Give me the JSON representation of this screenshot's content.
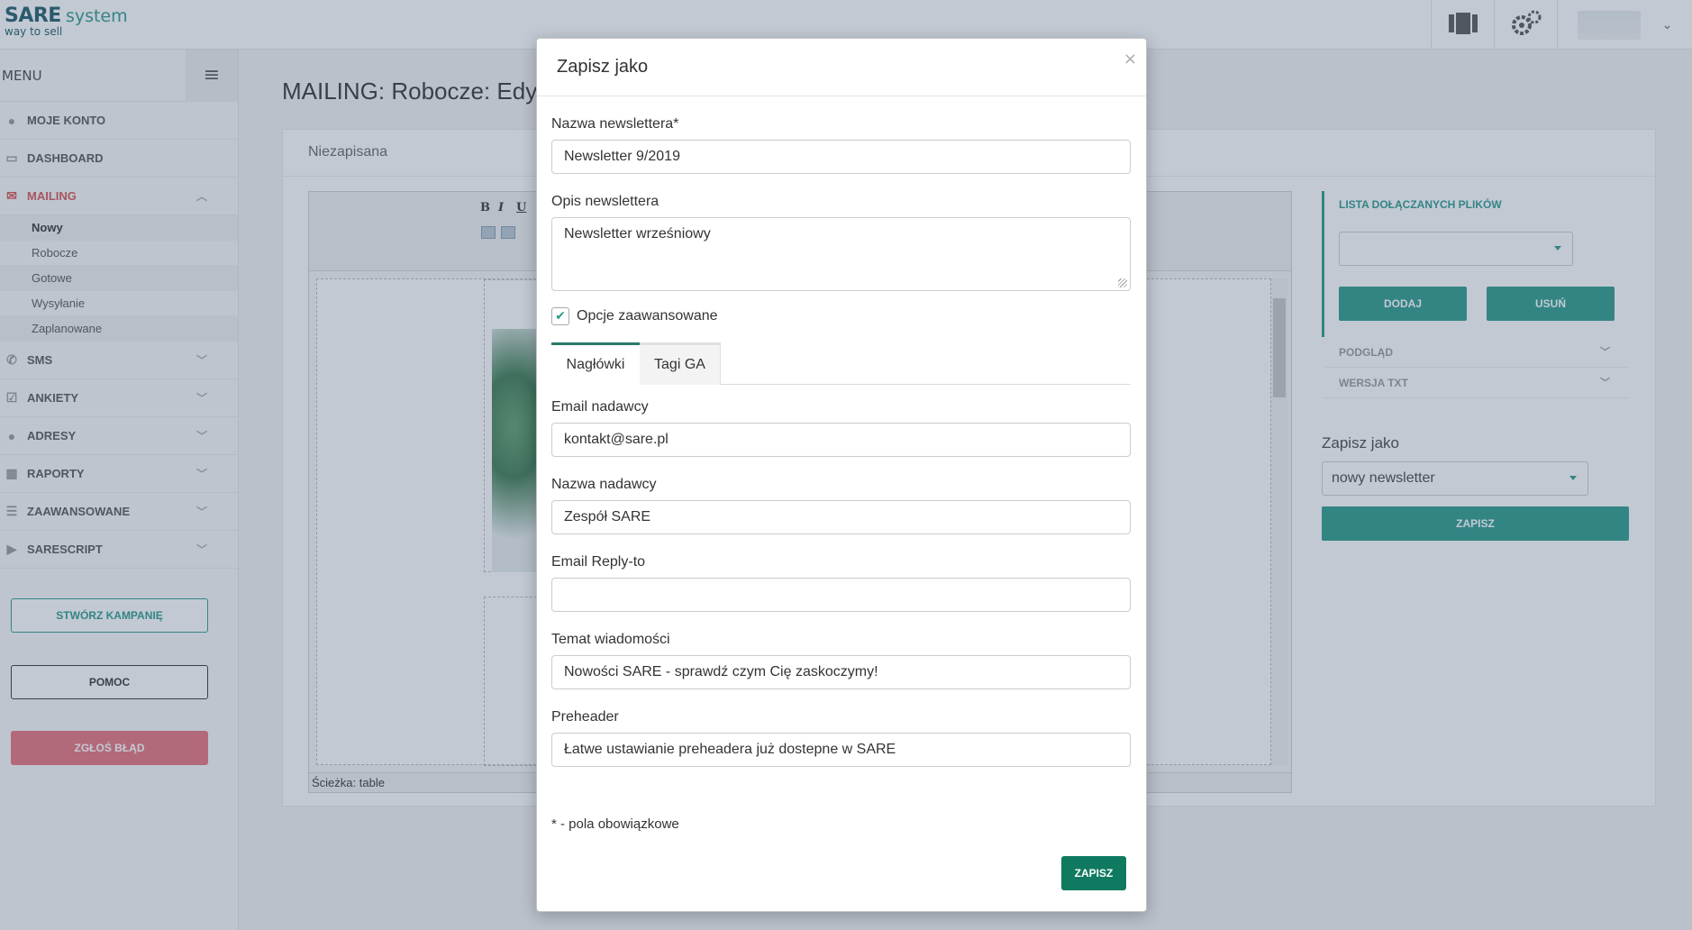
{
  "app": {
    "logo_brand": "SARE",
    "logo_product": "system",
    "logo_tagline": "way to sell",
    "icons": {
      "top_library": "library-icon",
      "top_settings": "gears-icon",
      "user_dropdown": "chevron-down-icon"
    }
  },
  "sidebar": {
    "menu_label": "MENU",
    "items": [
      {
        "label": "MOJE KONTO",
        "icon": "user-icon"
      },
      {
        "label": "DASHBOARD",
        "icon": "monitor-icon"
      },
      {
        "label": "MAILING",
        "icon": "envelope-icon"
      },
      {
        "label": "SMS",
        "icon": "phone-icon"
      },
      {
        "label": "ANKIETY",
        "icon": "checkbox-icon"
      },
      {
        "label": "ADRESY",
        "icon": "user-icon"
      },
      {
        "label": "RAPORTY",
        "icon": "table-icon"
      },
      {
        "label": "ZAAWANSOWANE",
        "icon": "list-icon"
      },
      {
        "label": "SARESCRIPT",
        "icon": "play-icon"
      }
    ],
    "mailing_sub": [
      "Nowy",
      "Robocze",
      "Gotowe",
      "Wysyłanie",
      "Zaplanowane"
    ],
    "buttons": {
      "create": "STWÓRZ KAMPANIĘ",
      "help": "POMOC",
      "bug": "ZGŁOŚ BŁĄD"
    }
  },
  "main": {
    "title": "MAILING: Robocze: Edyto",
    "panel_status": "Niezapisana",
    "editor_path": "Ścieżka: table",
    "toolbar": {
      "bold": "B",
      "italic": "I",
      "underline": "U"
    }
  },
  "right_panel": {
    "attachments_title": "LISTA DOŁĄCZANYCH PLIKÓW",
    "add_label": "DODAJ",
    "remove_label": "USUŃ",
    "preview_label": "PODGLĄD",
    "txt_label": "WERSJA TXT",
    "save_as_title": "Zapisz jako",
    "save_as_value": "nowy newsletter",
    "save_label": "ZAPISZ"
  },
  "modal": {
    "title": "Zapisz jako",
    "close": "×",
    "fields": {
      "name_label": "Nazwa newslettera*",
      "name_value": "Newsletter 9/2019",
      "desc_label": "Opis newslettera",
      "desc_value": "Newsletter wrześniowy",
      "advanced_label": "Opcje zaawansowane",
      "advanced_checked": true,
      "sender_email_label": "Email nadawcy",
      "sender_email_value": "kontakt@sare.pl",
      "sender_name_label": "Nazwa nadawcy",
      "sender_name_value": "Zespół SARE",
      "reply_to_label": "Email Reply-to",
      "reply_to_value": "",
      "subject_label": "Temat wiadomości",
      "subject_value": "Nowości SARE - sprawdź czym Cię zaskoczymy!",
      "preheader_label": "Preheader",
      "preheader_value": "Łatwe ustawianie preheadera już dostepne w SARE"
    },
    "tabs": [
      "Nagłówki",
      "Tagi GA"
    ],
    "active_tab": "Nagłówki",
    "required_note": "* - pola obowiązkowe",
    "save_label": "ZAPISZ"
  },
  "colors": {
    "accent": "#2a9a8a",
    "mailing_active": "#d9534f",
    "save_button": "#0f7a5f",
    "bug_button": "#e8707a"
  }
}
